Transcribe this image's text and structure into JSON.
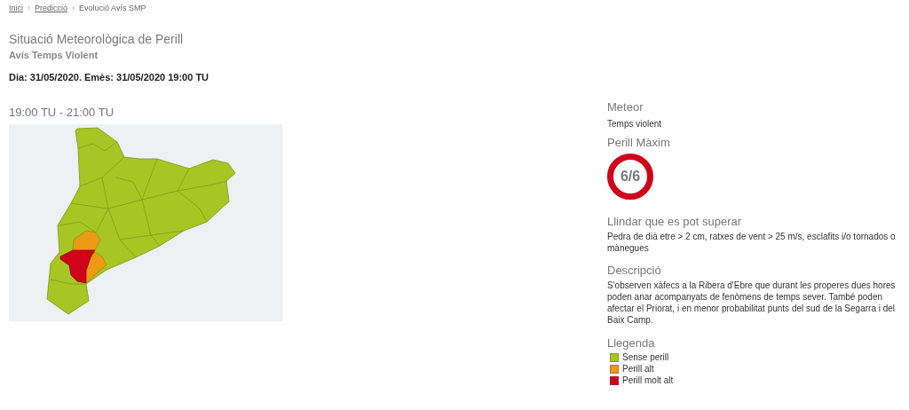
{
  "breadcrumb": [
    {
      "label": "Inici",
      "link": true
    },
    {
      "label": "Predicció",
      "link": true
    },
    {
      "label": "Evolució Avís SMP",
      "link": false
    }
  ],
  "breadcrumb_separator": "›",
  "title": "Situació Meteorològica de Perill",
  "subtitle": "Avís Temps Violent",
  "date_line": "Dia: 31/05/2020. Emès: 31/05/2020 19:00 TU",
  "period": "19:00 TU - 21:00 TU",
  "meteor": {
    "heading": "Meteor",
    "value": "Temps violent"
  },
  "max_danger": {
    "heading": "Perill Màxim",
    "value": "6/6",
    "color": "#d0021b"
  },
  "threshold": {
    "heading": "Llindar que es pot superar",
    "text": "Pedra de dià etre > 2 cm, ratxes de vent > 25 m/s, esclafits i/o tornados o mànegues"
  },
  "description": {
    "heading": "Descripció",
    "text": "S'observen xàfecs a la Ribera d'Ebre que durant les properes dues hores poden anar acompanyats de fenòmens de temps sever. També poden afectar el Priorat, i en menor probabilitat punts del sud de la Segarra i del Baix Camp."
  },
  "legend": {
    "heading": "Llegenda",
    "items": [
      {
        "label": "Sense perill",
        "color": "#a8c523"
      },
      {
        "label": "Perill alt",
        "color": "#ec9a13"
      },
      {
        "label": "Perill molt alt",
        "color": "#d0021b"
      }
    ]
  }
}
